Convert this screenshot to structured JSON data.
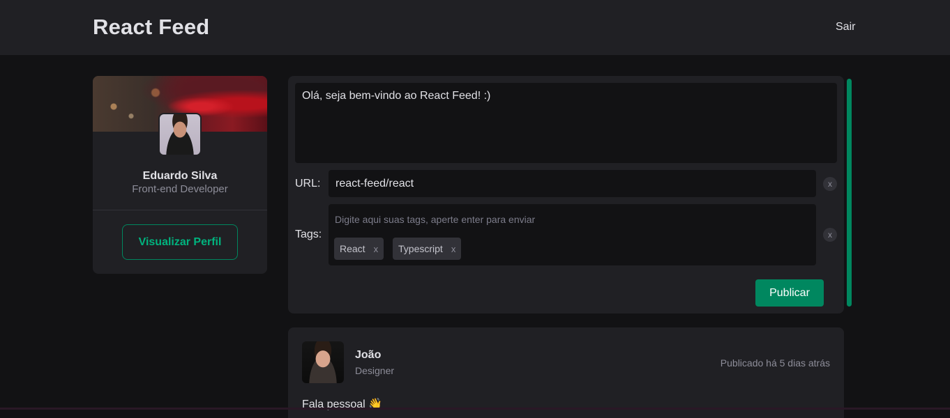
{
  "header": {
    "title": "React Feed",
    "logout_label": "Sair"
  },
  "profile": {
    "name": "Eduardo Silva",
    "role": "Front-end Developer",
    "view_profile_label": "Visualizar Perfil"
  },
  "composer": {
    "message": "Olá, seja bem-vindo ao React Feed! :)",
    "url_label": "URL:",
    "url_value": "react-feed/react",
    "tags_label": "Tags:",
    "tags_placeholder": "Digite aqui suas tags, aperte enter para enviar",
    "tags": [
      {
        "label": "React",
        "remove": "x"
      },
      {
        "label": "Typescript",
        "remove": "x"
      }
    ],
    "clear_label": "x",
    "publish_label": "Publicar"
  },
  "post": {
    "author_name": "João",
    "author_role": "Designer",
    "published": "Publicado há 5 dias atrás",
    "content": "Fala pessoal 👋"
  },
  "colors": {
    "accent": "#00875f",
    "accent_text": "#00b37e",
    "background": "#121214",
    "surface": "#202024"
  }
}
